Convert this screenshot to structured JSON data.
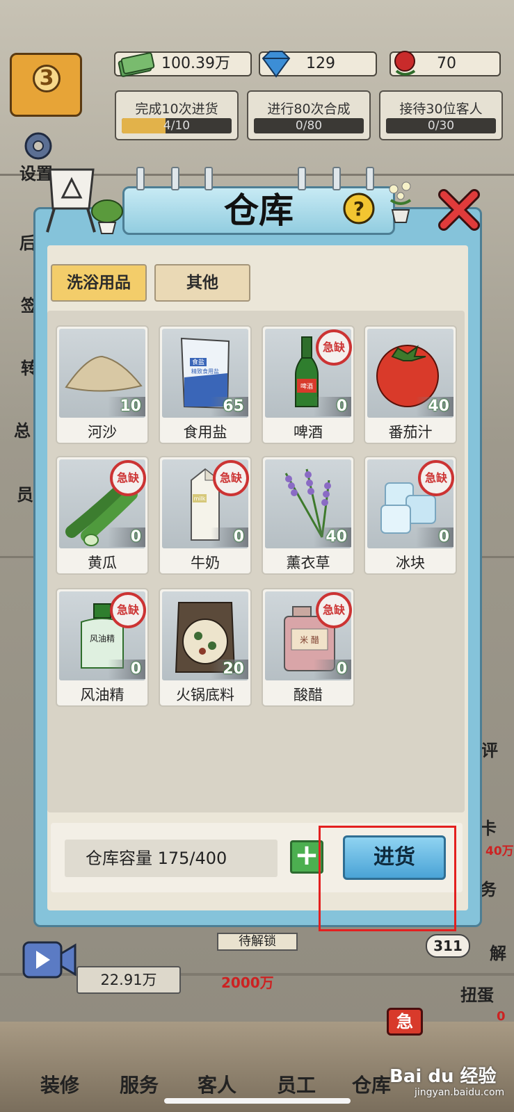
{
  "resources": {
    "money": "100.39万",
    "diamonds": "129",
    "roses": "70"
  },
  "level": "3",
  "tasks": [
    {
      "label": "完成10次进货",
      "progress": "4/10",
      "ratio": 0.4
    },
    {
      "label": "进行80次合成",
      "progress": "0/80",
      "ratio": 0
    },
    {
      "label": "接待30位客人",
      "progress": "0/30",
      "ratio": 0
    }
  ],
  "side": {
    "settings": "设置",
    "left_partial": [
      "后",
      "签",
      "转",
      "总",
      "员"
    ],
    "right_partial": [
      "评",
      "卡",
      "40万",
      "务",
      "311",
      "解",
      "扭蛋",
      "0万"
    ]
  },
  "warehouse": {
    "title": "仓库",
    "tabs": [
      {
        "label": "洗浴用品",
        "active": true
      },
      {
        "label": "其他",
        "active": false
      }
    ],
    "shortage_label": "急缺",
    "items": [
      {
        "name": "河沙",
        "count": "10",
        "shortage": false,
        "icon": "sand-pile-icon"
      },
      {
        "name": "食用盐",
        "count": "65",
        "shortage": false,
        "icon": "salt-bag-icon"
      },
      {
        "name": "啤酒",
        "count": "0",
        "shortage": true,
        "icon": "beer-bottle-icon"
      },
      {
        "name": "番茄汁",
        "count": "40",
        "shortage": false,
        "icon": "tomato-icon"
      },
      {
        "name": "黄瓜",
        "count": "0",
        "shortage": true,
        "icon": "cucumber-icon"
      },
      {
        "name": "牛奶",
        "count": "0",
        "shortage": true,
        "icon": "milk-carton-icon"
      },
      {
        "name": "薰衣草",
        "count": "40",
        "shortage": false,
        "icon": "lavender-icon"
      },
      {
        "name": "冰块",
        "count": "0",
        "shortage": true,
        "icon": "ice-cube-icon"
      },
      {
        "name": "风油精",
        "count": "0",
        "shortage": true,
        "icon": "oil-bottle-icon"
      },
      {
        "name": "火锅底料",
        "count": "20",
        "shortage": false,
        "icon": "hotpot-base-icon"
      },
      {
        "name": "酸醋",
        "count": "0",
        "shortage": true,
        "icon": "vinegar-jug-icon"
      }
    ],
    "capacity_label": "仓库容量 175/400",
    "restock_button": "进货",
    "salt_pack_text": {
      "brand": "食盐",
      "sub": "精致食用盐"
    },
    "beer_label": "啤酒",
    "milk_label": "milk",
    "oil_label": "风油精",
    "vinegar_label": "米 醋"
  },
  "bottom": {
    "income": "22.91万",
    "cost": "2000万",
    "unlock": "待解锁",
    "nav": [
      "装修",
      "服务",
      "客人",
      "员工",
      "仓库"
    ],
    "badge": "急"
  },
  "watermark": "Bai du 经验",
  "watermark_url": "jingyan.baidu.com"
}
